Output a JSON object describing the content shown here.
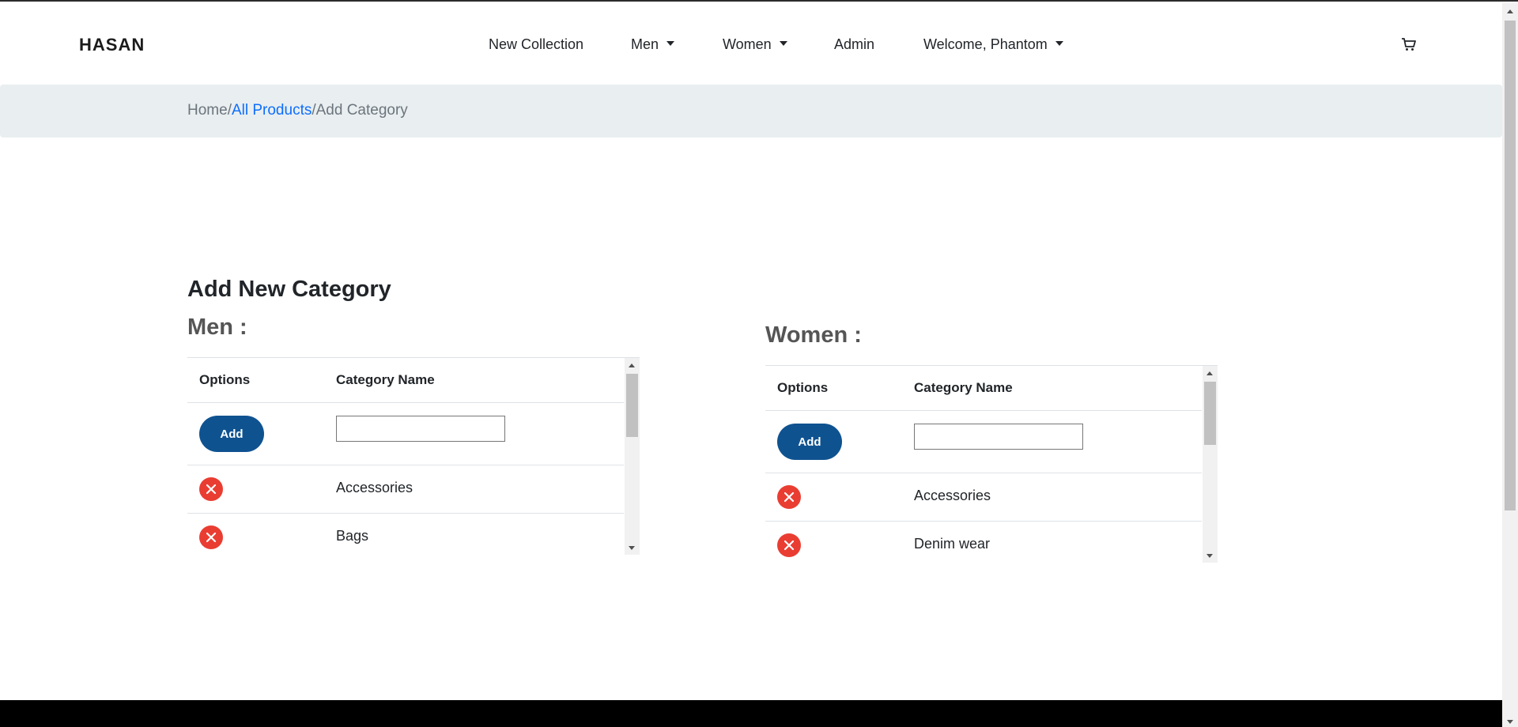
{
  "navbar": {
    "brand": "HASAN",
    "items": [
      {
        "label": "New Collection"
      },
      {
        "label": "Men"
      },
      {
        "label": "Women"
      },
      {
        "label": "Admin"
      },
      {
        "label": "Welcome, Phantom"
      }
    ],
    "cart_icon": "cart-icon"
  },
  "breadcrumb": {
    "home": "Home",
    "all_products": "All Products",
    "current": "Add Category",
    "separator": "/"
  },
  "page_title": "Add New Category",
  "sections": [
    {
      "title": "Men :",
      "headers": {
        "options": "Options",
        "name": "Category Name"
      },
      "add_label": "Add",
      "input_value": "",
      "rows": [
        "Accessories",
        "Bags"
      ]
    },
    {
      "title": "Women :",
      "headers": {
        "options": "Options",
        "name": "Category Name"
      },
      "add_label": "Add",
      "input_value": "",
      "rows": [
        "Accessories",
        "Denim wear"
      ]
    }
  ],
  "colors": {
    "add_button": "#0f5290",
    "delete_button": "#ea3d32",
    "link": "#0d6efd",
    "breadcrumb_bg": "#e9eef0"
  }
}
